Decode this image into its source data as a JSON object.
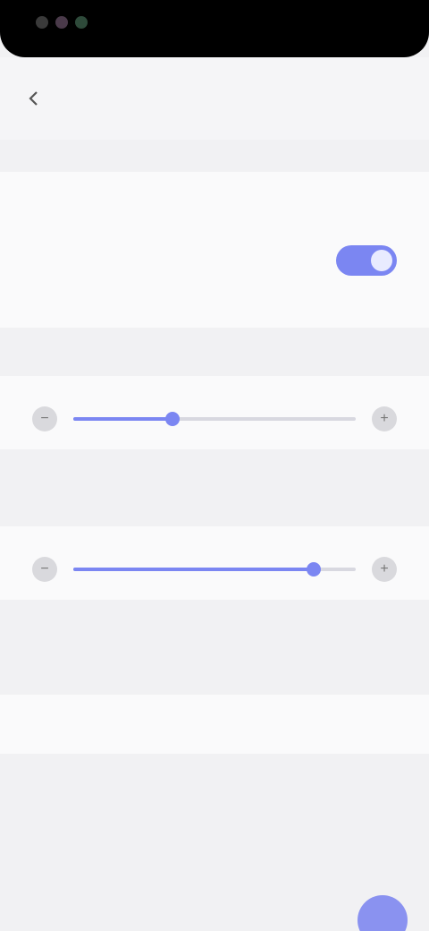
{
  "appbar": {
    "title": ""
  },
  "sections": {
    "first_label": "",
    "second_label": "",
    "third_label": "",
    "fourth_label": ""
  },
  "rows": {
    "row1_title": "",
    "row1_value": "",
    "row2_title": "",
    "block_title": "",
    "block_desc": ""
  },
  "sliders": {
    "one_title": "",
    "one_value": 0.35,
    "one_caption_text": "",
    "one_caption_link": "",
    "two_title": "",
    "two_value": 0.85,
    "two_caption_text": "",
    "two_caption_link": ""
  },
  "bottom": {
    "row_title": ""
  },
  "colors": {
    "accent": "#7b86f2",
    "background": "#f1f1f3"
  },
  "icons": {
    "back": "arrow-left-icon",
    "minus": "minus-icon",
    "plus": "plus-icon"
  }
}
